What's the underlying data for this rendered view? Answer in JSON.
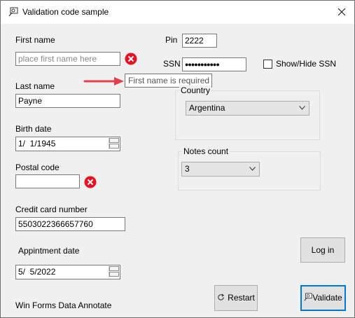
{
  "window": {
    "title": "Validation code sample"
  },
  "form": {
    "first_name": {
      "label": "First name",
      "placeholder": "place first name here",
      "value": "",
      "error_tooltip": "First name is required"
    },
    "last_name": {
      "label": "Last name",
      "value": "Payne"
    },
    "birth_date": {
      "label": "Birth date",
      "value": "1/  1/1945"
    },
    "postal_code": {
      "label": "Postal code",
      "value": ""
    },
    "credit_card": {
      "label": "Credit card number",
      "value": "5503022366657760"
    },
    "appointment_date": {
      "label": "Appintment date",
      "value": "5/  5/2022"
    },
    "pin": {
      "label": "Pin",
      "value": "2222"
    },
    "ssn": {
      "label": "SSN",
      "value": "●●●●●●●●●●●"
    },
    "show_hide_ssn": {
      "label": "Show/Hide SSN",
      "checked": false
    },
    "country": {
      "label": "Country",
      "selected": "Argentina"
    },
    "notes_count": {
      "label": "Notes count",
      "selected": "3"
    },
    "footer_label": "Win Forms Data Annotate"
  },
  "buttons": {
    "login": "Log in",
    "restart": "Restart",
    "validate": "Validate"
  },
  "colors": {
    "error": "#e81123",
    "arrow": "#e2404b",
    "focus": "#0078d7"
  }
}
